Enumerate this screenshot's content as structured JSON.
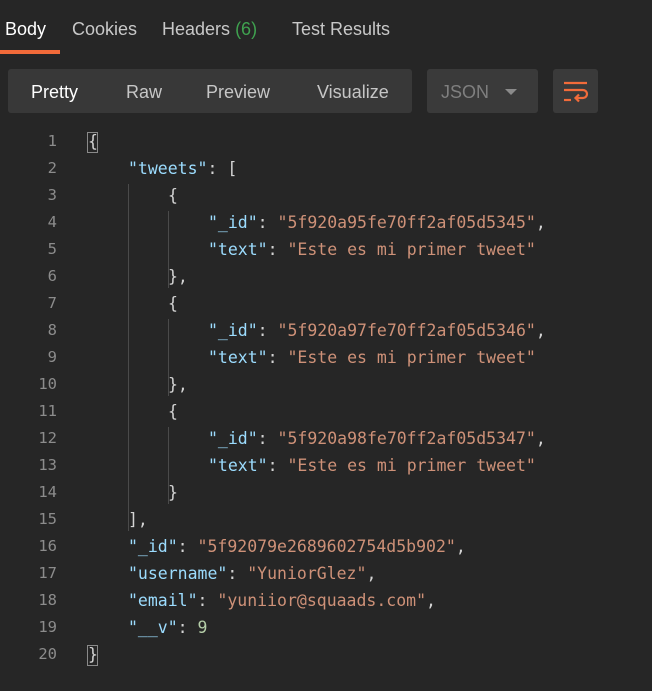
{
  "tabs": {
    "body": "Body",
    "cookies": "Cookies",
    "headers": "Headers",
    "headers_count": "(6)",
    "test_results": "Test Results"
  },
  "view_modes": {
    "pretty": "Pretty",
    "raw": "Raw",
    "preview": "Preview",
    "visualize": "Visualize"
  },
  "format_select": {
    "value": "JSON"
  },
  "colors": {
    "accent": "#f26b3a",
    "count_green": "#3fa14f",
    "json_key": "#9cdcfe",
    "json_string": "#ce9178",
    "json_number": "#b5cea8"
  },
  "code": {
    "line_numbers": [
      "1",
      "2",
      "3",
      "4",
      "5",
      "6",
      "7",
      "8",
      "9",
      "10",
      "11",
      "12",
      "13",
      "14",
      "15",
      "16",
      "17",
      "18",
      "19",
      "20"
    ],
    "lines": [
      [
        {
          "t": "{",
          "c": "p"
        }
      ],
      [
        {
          "t": "\"tweets\"",
          "c": "k"
        },
        {
          "t": ": [",
          "c": "p"
        }
      ],
      [
        {
          "t": "{",
          "c": "p"
        }
      ],
      [
        {
          "t": "\"_id\"",
          "c": "k"
        },
        {
          "t": ": ",
          "c": "p"
        },
        {
          "t": "\"5f920a95fe70ff2af05d5345\"",
          "c": "s"
        },
        {
          "t": ",",
          "c": "p"
        }
      ],
      [
        {
          "t": "\"text\"",
          "c": "k"
        },
        {
          "t": ": ",
          "c": "p"
        },
        {
          "t": "\"Este es mi primer tweet\"",
          "c": "s"
        }
      ],
      [
        {
          "t": "},",
          "c": "p"
        }
      ],
      [
        {
          "t": "{",
          "c": "p"
        }
      ],
      [
        {
          "t": "\"_id\"",
          "c": "k"
        },
        {
          "t": ": ",
          "c": "p"
        },
        {
          "t": "\"5f920a97fe70ff2af05d5346\"",
          "c": "s"
        },
        {
          "t": ",",
          "c": "p"
        }
      ],
      [
        {
          "t": "\"text\"",
          "c": "k"
        },
        {
          "t": ": ",
          "c": "p"
        },
        {
          "t": "\"Este es mi primer tweet\"",
          "c": "s"
        }
      ],
      [
        {
          "t": "},",
          "c": "p"
        }
      ],
      [
        {
          "t": "{",
          "c": "p"
        }
      ],
      [
        {
          "t": "\"_id\"",
          "c": "k"
        },
        {
          "t": ": ",
          "c": "p"
        },
        {
          "t": "\"5f920a98fe70ff2af05d5347\"",
          "c": "s"
        },
        {
          "t": ",",
          "c": "p"
        }
      ],
      [
        {
          "t": "\"text\"",
          "c": "k"
        },
        {
          "t": ": ",
          "c": "p"
        },
        {
          "t": "\"Este es mi primer tweet\"",
          "c": "s"
        }
      ],
      [
        {
          "t": "}",
          "c": "p"
        }
      ],
      [
        {
          "t": "],",
          "c": "p"
        }
      ],
      [
        {
          "t": "\"_id\"",
          "c": "k"
        },
        {
          "t": ": ",
          "c": "p"
        },
        {
          "t": "\"5f92079e2689602754d5b902\"",
          "c": "s"
        },
        {
          "t": ",",
          "c": "p"
        }
      ],
      [
        {
          "t": "\"username\"",
          "c": "k"
        },
        {
          "t": ": ",
          "c": "p"
        },
        {
          "t": "\"YuniorGlez\"",
          "c": "s"
        },
        {
          "t": ",",
          "c": "p"
        }
      ],
      [
        {
          "t": "\"email\"",
          "c": "k"
        },
        {
          "t": ": ",
          "c": "p"
        },
        {
          "t": "\"yuniior@squaads.com\"",
          "c": "s"
        },
        {
          "t": ",",
          "c": "p"
        }
      ],
      [
        {
          "t": "\"__v\"",
          "c": "k"
        },
        {
          "t": ": ",
          "c": "p"
        },
        {
          "t": "9",
          "c": "n"
        }
      ],
      [
        {
          "t": "}",
          "c": "p"
        }
      ]
    ]
  }
}
